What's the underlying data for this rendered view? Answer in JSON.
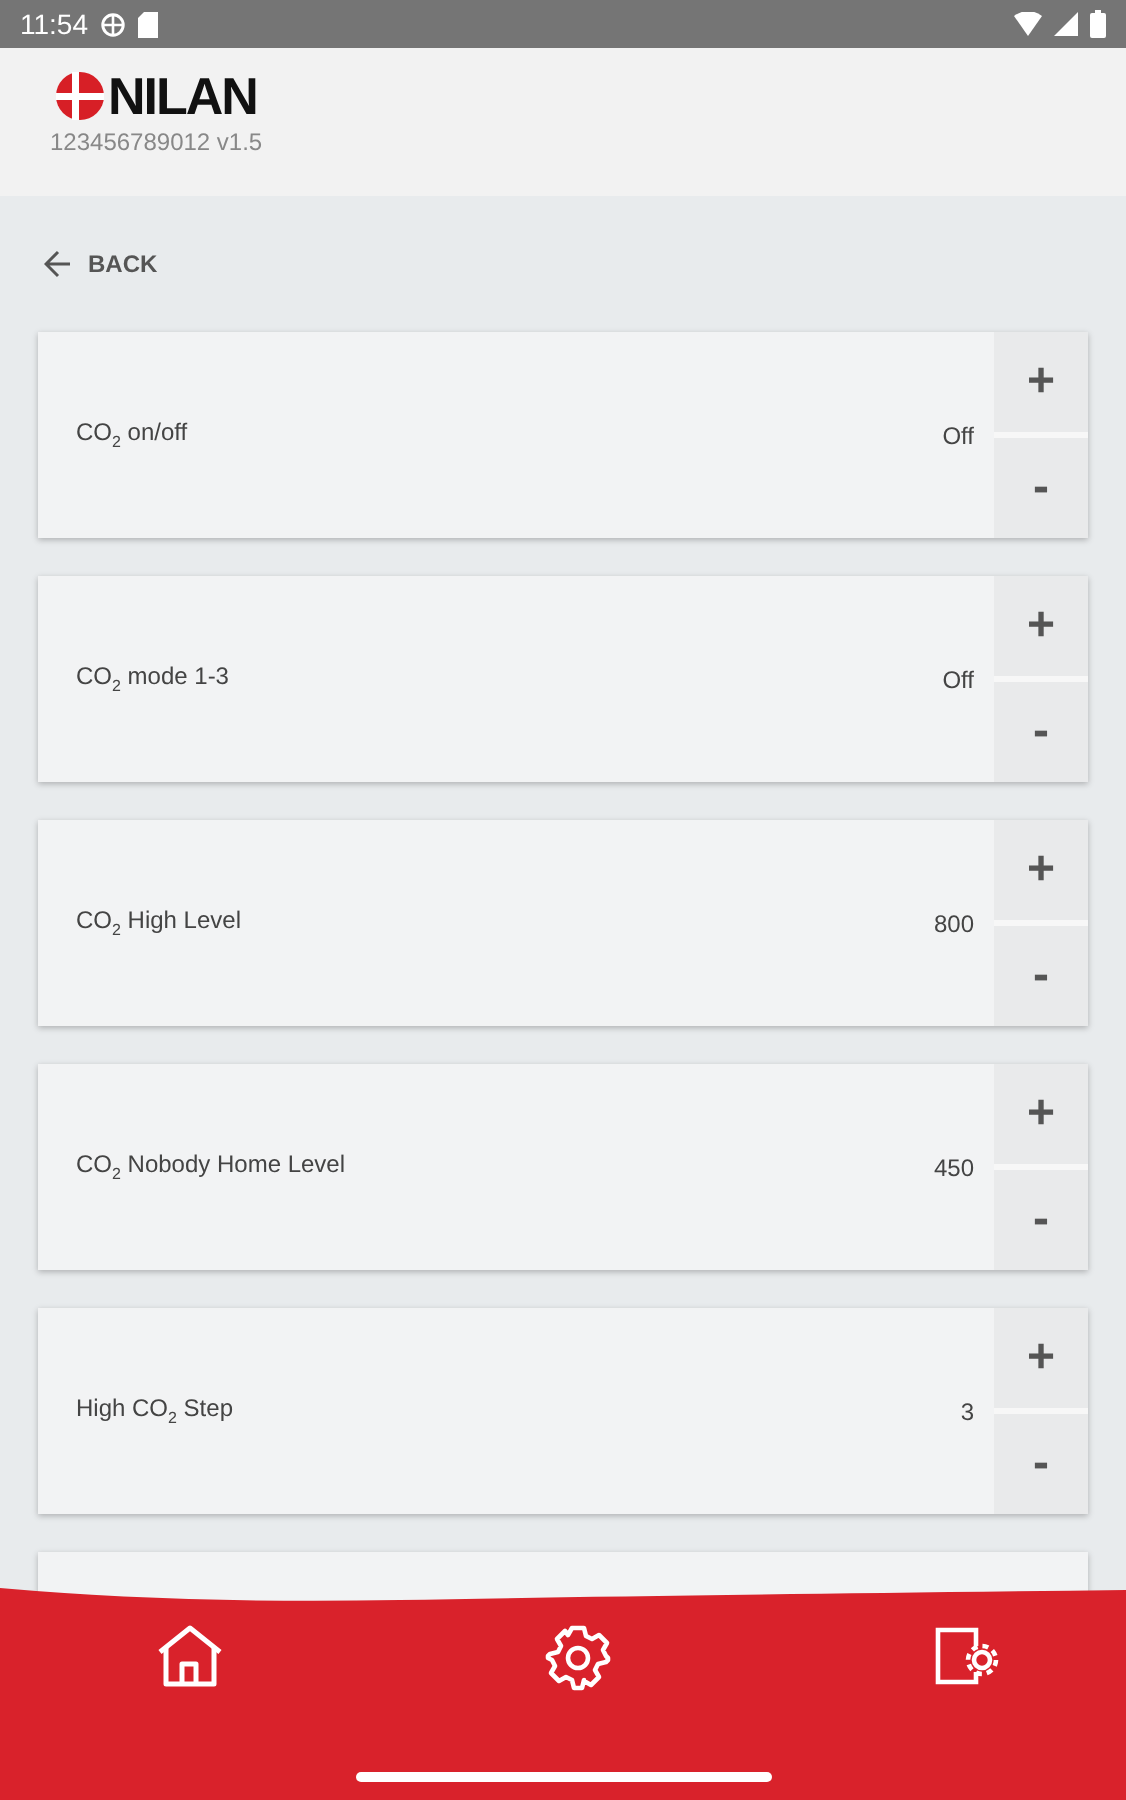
{
  "status_bar": {
    "time": "11:54"
  },
  "header": {
    "logo": "NILAN",
    "device": "123456789012 v1.5"
  },
  "back": {
    "label": "BACK"
  },
  "settings": [
    {
      "label": "CO$_{2}$ on/off",
      "value": "Off",
      "increase": "+",
      "decrease": "-"
    },
    {
      "label": "CO$_{2}$ mode 1-3",
      "value": "Off",
      "increase": "+",
      "decrease": "-"
    },
    {
      "label": "CO$_{2}$ High Level",
      "value": "800",
      "increase": "+",
      "decrease": "-"
    },
    {
      "label": "CO$_{2}$ Nobody Home Level",
      "value": "450",
      "increase": "+",
      "decrease": "-"
    },
    {
      "label": "High CO$_{2}$ Step",
      "value": "3",
      "increase": "+",
      "decrease": "-"
    }
  ],
  "bottom_nav": [
    {
      "kind": "home"
    },
    {
      "kind": "settings"
    },
    {
      "kind": "device"
    }
  ]
}
